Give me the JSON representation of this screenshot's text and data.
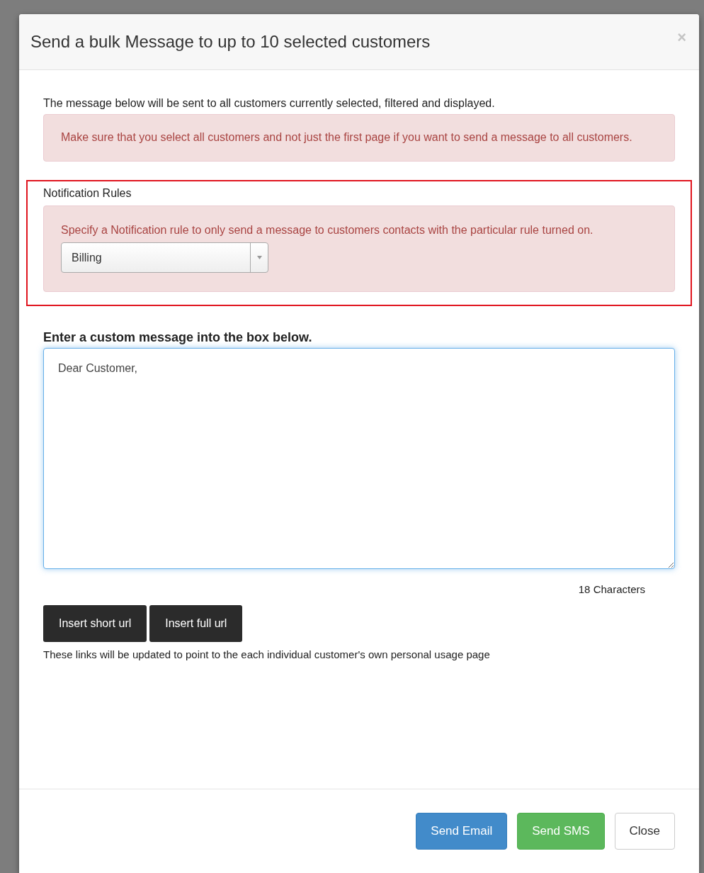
{
  "dialog": {
    "title": "Send a bulk Message to up to 10 selected customers",
    "close_symbol": "×"
  },
  "intro": "The message below will be sent to all customers currently selected, filtered and displayed.",
  "warning": "Make sure that you select all customers and not just the first page if you want to send a message to all customers.",
  "notification_rules": {
    "label": "Notification Rules",
    "highlighted": true,
    "text": "Specify a Notification rule to only send a message to customers contacts with the particular rule turned on.",
    "select": {
      "value": "Billing"
    }
  },
  "message": {
    "label": "Enter a custom message into the box below.",
    "value": "Dear Customer,\n\n",
    "focused": true,
    "count": "18 Characters"
  },
  "insert_buttons": [
    "Insert short url",
    "Insert full url"
  ],
  "insert_hint": "These links will be updated to point to the each individual customer's own personal usage page",
  "footer_buttons": [
    {
      "label": "Send Email",
      "kind": "primary"
    },
    {
      "label": "Send SMS",
      "kind": "success"
    },
    {
      "label": "Close",
      "kind": "default"
    }
  ]
}
